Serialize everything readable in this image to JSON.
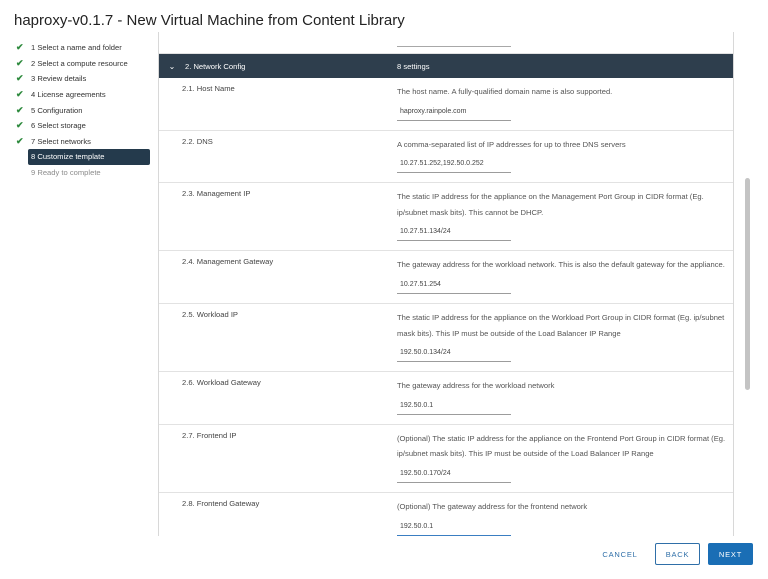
{
  "window": {
    "title": "haproxy-v0.1.7 - New Virtual Machine from Content Library"
  },
  "steps": [
    {
      "label": "1 Select a name and folder",
      "status": "done"
    },
    {
      "label": "2 Select a compute resource",
      "status": "done"
    },
    {
      "label": "3 Review details",
      "status": "done"
    },
    {
      "label": "4 License agreements",
      "status": "done"
    },
    {
      "label": "5 Configuration",
      "status": "done"
    },
    {
      "label": "6 Select storage",
      "status": "done"
    },
    {
      "label": "7 Select networks",
      "status": "done"
    },
    {
      "label": "8 Customize template",
      "status": "active"
    },
    {
      "label": "9 Ready to complete",
      "status": "pending"
    }
  ],
  "group": {
    "name": "2. Network Config",
    "count": "8 settings"
  },
  "settings": [
    {
      "id": "host-name",
      "label": "2.1. Host Name",
      "description": "The host name. A fully-qualified domain name is also supported.",
      "value": "haproxy.rainpole.com"
    },
    {
      "id": "dns",
      "label": "2.2. DNS",
      "description": "A comma-separated list of IP addresses for up to three DNS servers",
      "value": "10.27.51.252,192.50.0.252"
    },
    {
      "id": "management-ip",
      "label": "2.3. Management IP",
      "description": "The static IP address for the appliance on the Management Port Group in CIDR format (Eg. ip/subnet mask bits). This cannot be DHCP.",
      "value": "10.27.51.134/24"
    },
    {
      "id": "management-gateway",
      "label": "2.4. Management Gateway",
      "description": "The gateway address for the workload network. This is also the default gateway for the appliance.",
      "value": "10.27.51.254"
    },
    {
      "id": "workload-ip",
      "label": "2.5. Workload IP",
      "description": "The static IP address for the appliance on the Workload Port Group in CIDR format (Eg. ip/subnet mask bits). This IP must be outside of the Load Balancer IP Range",
      "value": "192.50.0.134/24"
    },
    {
      "id": "workload-gateway",
      "label": "2.6. Workload Gateway",
      "description": "The gateway address for the workload network",
      "value": "192.50.0.1"
    },
    {
      "id": "frontend-ip",
      "label": "2.7. Frontend IP",
      "description": "(Optional) The static IP address for the appliance on the Frontend Port Group in CIDR format (Eg. ip/subnet mask bits). This IP must be outside of the Load Balancer IP Range",
      "value": "192.50.0.170/24"
    },
    {
      "id": "frontend-gateway",
      "label": "2.8. Frontend Gateway",
      "description": "(Optional) The gateway address for the frontend network",
      "value": "192.50.0.1",
      "focused": true
    }
  ],
  "footer": {
    "cancel_label": "CANCEL",
    "back_label": "BACK",
    "next_label": "NEXT"
  },
  "colors": {
    "header": "#2e3e4d",
    "active_step": "#243a4c",
    "primary": "#1a6eb5",
    "check": "#2e8a3e"
  },
  "icons": {
    "step_done": "check-icon",
    "group_toggle": "chevron-down-icon"
  }
}
